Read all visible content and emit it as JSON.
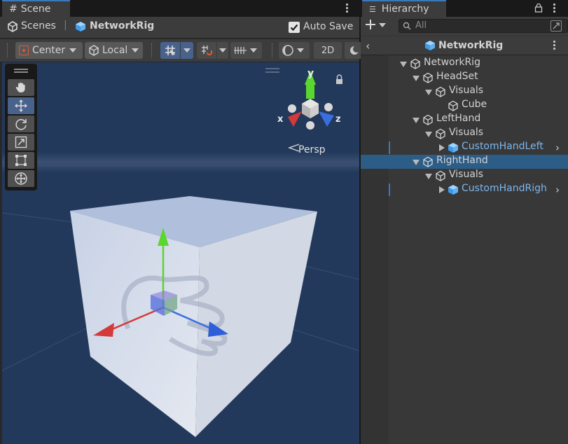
{
  "scene_tab": {
    "label": "Scene"
  },
  "scene_bar": {
    "scenes_label": "Scenes",
    "separator": "|",
    "prefab_name": "NetworkRig",
    "autosave_label": "Auto Save",
    "autosave_checked": true
  },
  "toolbar": {
    "pivot_label": "Center",
    "space_label": "Local",
    "mode_2d_label": "2D"
  },
  "gizmo": {
    "axis_x": "x",
    "axis_y": "y",
    "axis_z": "z",
    "projection_label": "Persp"
  },
  "tools": [
    "hand-tool",
    "move-tool",
    "rotate-tool",
    "scale-tool",
    "rect-tool",
    "transform-tool"
  ],
  "hierarchy_tab": {
    "label": "Hierarchy"
  },
  "hierarchy_search": {
    "placeholder": "All"
  },
  "hierarchy_header": {
    "title": "NetworkRig"
  },
  "hierarchy_items": [
    {
      "label": "NetworkRig",
      "depth": 0,
      "expanded": true,
      "prefab": false,
      "selected": false
    },
    {
      "label": "HeadSet",
      "depth": 1,
      "expanded": true,
      "prefab": false,
      "selected": false
    },
    {
      "label": "Visuals",
      "depth": 2,
      "expanded": true,
      "prefab": false,
      "selected": false
    },
    {
      "label": "Cube",
      "depth": 3,
      "expanded": null,
      "prefab": false,
      "selected": false
    },
    {
      "label": "LeftHand",
      "depth": 1,
      "expanded": true,
      "prefab": false,
      "selected": false
    },
    {
      "label": "Visuals",
      "depth": 2,
      "expanded": true,
      "prefab": false,
      "selected": false
    },
    {
      "label": "CustomHandLeft",
      "depth": 3,
      "expanded": false,
      "prefab": true,
      "selected": false
    },
    {
      "label": "RightHand",
      "depth": 1,
      "expanded": true,
      "prefab": false,
      "selected": true
    },
    {
      "label": "Visuals",
      "depth": 2,
      "expanded": true,
      "prefab": false,
      "selected": false
    },
    {
      "label": "CustomHandRigh",
      "depth": 3,
      "expanded": false,
      "prefab": true,
      "selected": false
    }
  ],
  "colors": {
    "accent": "#3a79bb",
    "selection": "#2c5d87",
    "prefab_text": "#7bb6ec",
    "viewport_bg": "#23395b",
    "axis_x": "#d43a3a",
    "axis_y": "#5bd62f",
    "axis_z": "#3a6ee0"
  }
}
